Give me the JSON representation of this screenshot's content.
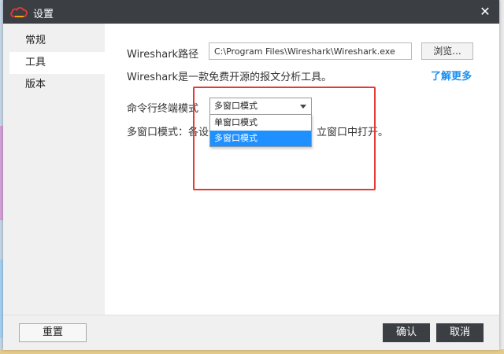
{
  "window": {
    "title": "设置"
  },
  "sidebar": {
    "items": [
      {
        "label": "常规"
      },
      {
        "label": "工具"
      },
      {
        "label": "版本"
      }
    ]
  },
  "tools": {
    "wireshark_label": "Wireshark路径",
    "wireshark_path": "C:\\Program Files\\Wireshark\\Wireshark.exe",
    "browse_label": "浏览...",
    "description": "Wireshark是一款免费开源的报文分析工具。",
    "learn_more": "了解更多",
    "terminal_mode_label": "命令行终端模式",
    "selected_mode": "多窗口模式",
    "mode_options": [
      "单窗口模式",
      "多窗口模式"
    ],
    "mode_description_left": "多窗口模式：各设备",
    "mode_description_right": "立窗口中打开。"
  },
  "footer": {
    "reset_label": "重置",
    "ok_label": "确认",
    "cancel_label": "取消"
  },
  "colors": {
    "titlebar": "#3b3f44",
    "link": "#1b8ff0",
    "selection": "#1e90ff",
    "annotation": "#e53935"
  }
}
